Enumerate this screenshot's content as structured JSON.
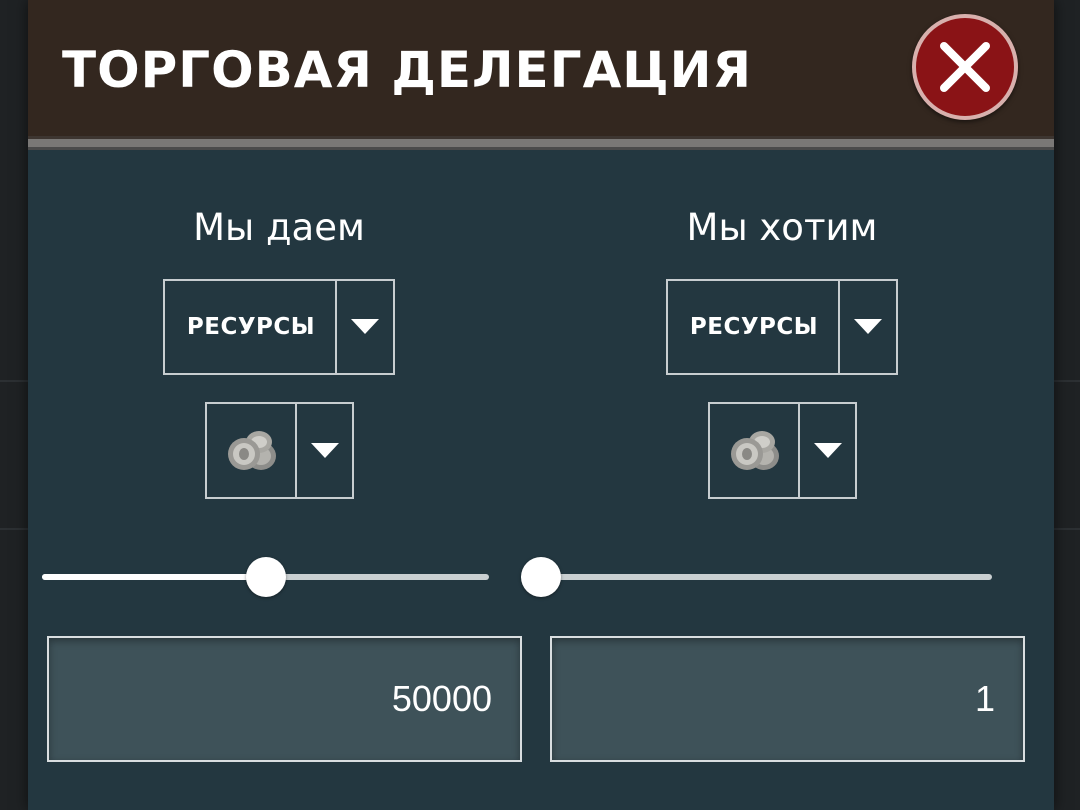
{
  "dialog": {
    "title": "ТОРГОВАЯ ДЕЛЕГАЦИЯ",
    "close_icon": "close-x-icon",
    "colors": {
      "header_bg": "#33271f",
      "panel_bg": "#233740",
      "close_button": "#8a1316",
      "input_bg": "#3e5259"
    }
  },
  "give": {
    "heading": "Мы даем",
    "category_select": {
      "value": "РЕСУРСЫ",
      "arrow_icon": "caret-down-icon"
    },
    "item_select": {
      "value_icon": "silver-coins-icon",
      "arrow_icon": "caret-down-icon"
    },
    "slider": {
      "fraction": 0.5
    },
    "amount": "50000"
  },
  "want": {
    "heading": "Мы хотим",
    "category_select": {
      "value": "РЕСУРСЫ",
      "arrow_icon": "caret-down-icon"
    },
    "item_select": {
      "value_icon": "silver-coins-icon",
      "arrow_icon": "caret-down-icon"
    },
    "slider": {
      "fraction": 0.0
    },
    "amount": "1"
  }
}
